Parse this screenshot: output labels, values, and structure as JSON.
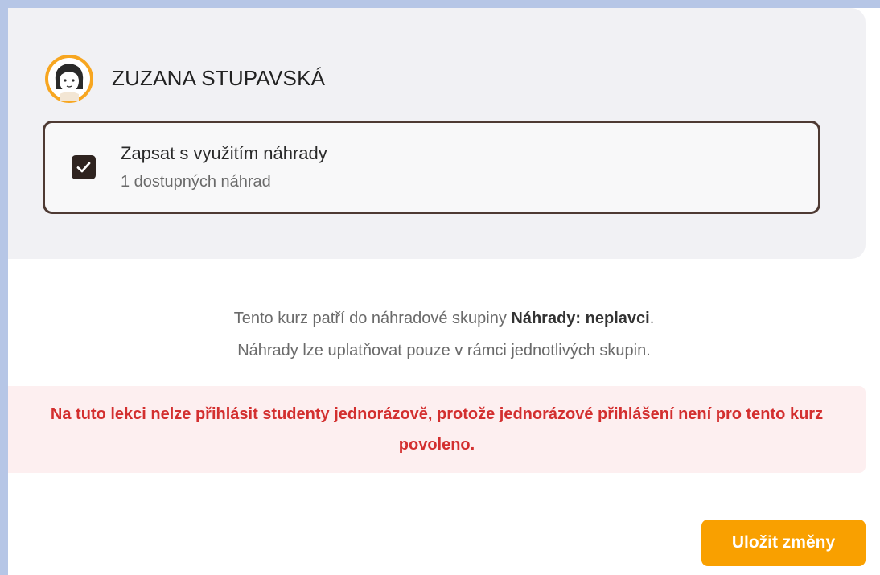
{
  "student": {
    "name": "ZUZANA STUPAVSKÁ",
    "avatar_icon": "avatar-icon"
  },
  "substitution_option": {
    "checked": true,
    "title": "Zapsat s využitím náhrady",
    "subtitle": "1 dostupných náhrad"
  },
  "info": {
    "line1_prefix": "Tento kurz patří do náhradové skupiny ",
    "group_name": "Náhrady: neplavci",
    "line1_suffix": ".",
    "line2": "Náhrady lze uplatňovat pouze v rámci jednotlivých skupin."
  },
  "error": {
    "message": "Na tuto lekci nelze přihlásit studenty jednorázově, protože jednorázové přihlášení není pro tento kurz povoleno."
  },
  "actions": {
    "save_label": "Uložit změny"
  },
  "colors": {
    "accent": "#f9a000",
    "error": "#d32f2f",
    "card_border": "#4e3a33"
  }
}
